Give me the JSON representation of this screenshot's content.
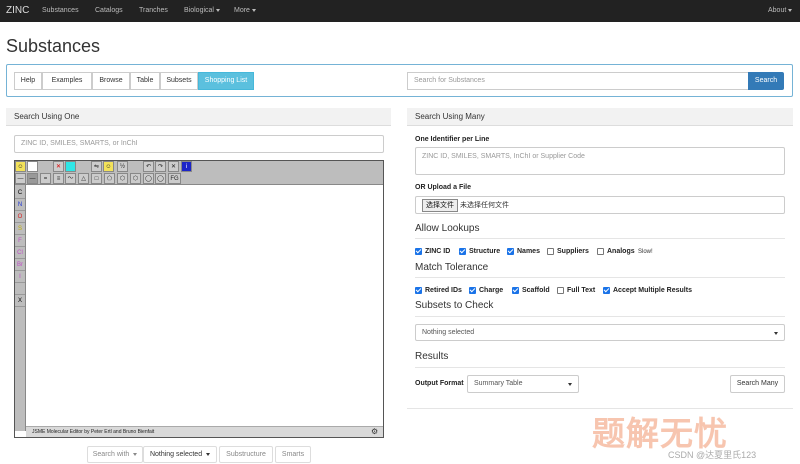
{
  "navbar": {
    "brand": "ZINC",
    "links": [
      "Substances",
      "Catalogs",
      "Tranches",
      "Biological",
      "More"
    ],
    "about": "About"
  },
  "page_title": "Substances",
  "tabs": [
    "Help",
    "Examples",
    "Browse",
    "Table",
    "Subsets",
    "Shopping List"
  ],
  "active_tab": "Shopping List",
  "top_search": {
    "placeholder": "Search for Substances",
    "button": "Search"
  },
  "left": {
    "header": "Search Using One",
    "input_placeholder": "ZINC ID, SMILES, SMARTS, or InChI",
    "jsme": {
      "atoms": [
        "C",
        "N",
        "O",
        "S",
        "F",
        "Cl",
        "Br",
        "I",
        "",
        "X"
      ],
      "atom_colors": [
        "#000000",
        "#1f35d6",
        "#d61f1f",
        "#c4b100",
        "#c04fc8",
        "#c04fc8",
        "#c04fc8",
        "#c04fc8",
        "#000000",
        "#000000"
      ],
      "fg_label": "FG",
      "credit": "JSME Molecular Editor by Peter Ertl and Bruno Bienfait"
    },
    "buttons": {
      "search_with": "Search with",
      "nothing_selected": "Nothing selected",
      "substructure": "Substructure",
      "smarts": "Smarts"
    }
  },
  "right": {
    "header": "Search Using Many",
    "one_per_line": "One Identifier per Line",
    "textarea_placeholder": "ZINC ID, SMILES, SMARTS, InChI or Supplier Code",
    "or_upload": "OR Upload a File",
    "file_button": "选择文件",
    "file_status": "未选择任何文件",
    "allow_lookups": {
      "title": "Allow Lookups",
      "items": [
        {
          "label": "ZINC ID",
          "checked": true
        },
        {
          "label": "Structure",
          "checked": true
        },
        {
          "label": "Names",
          "checked": true
        },
        {
          "label": "Suppliers",
          "checked": false
        },
        {
          "label": "Analogs",
          "checked": false
        }
      ],
      "analogs_note": "Slow!"
    },
    "match_tolerance": {
      "title": "Match Tolerance",
      "items": [
        {
          "label": "Retired IDs",
          "checked": true
        },
        {
          "label": "Charge",
          "checked": true
        },
        {
          "label": "Scaffold",
          "checked": true
        },
        {
          "label": "Full Text",
          "checked": false
        },
        {
          "label": "Accept Multiple Results",
          "checked": true
        }
      ]
    },
    "subsets": {
      "title": "Subsets to Check",
      "selected": "Nothing selected"
    },
    "results": {
      "title": "Results",
      "output_format_label": "Output Format",
      "output_format": "Summary Table",
      "search_many": "Search Many"
    }
  },
  "watermark": "题解无忧",
  "credit": "CSDN @达夏里氏123"
}
